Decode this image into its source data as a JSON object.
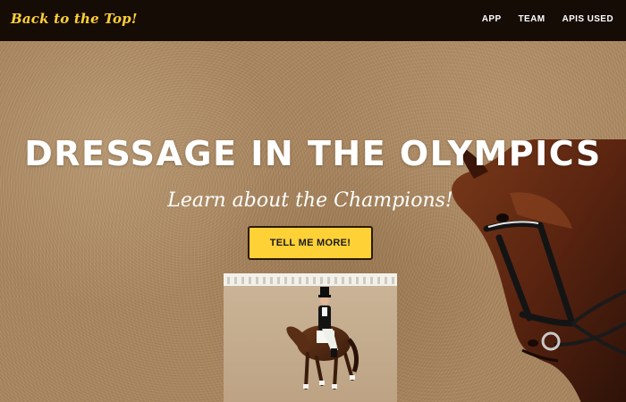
{
  "navbar": {
    "brand": "Back to the Top!",
    "links": [
      {
        "label": "APP"
      },
      {
        "label": "TEAM"
      },
      {
        "label": "APIS USED"
      }
    ]
  },
  "hero": {
    "title": "DRESSAGE IN THE OLYMPICS",
    "subtitle": "Learn about the Champions!",
    "button_label": "TELL ME MORE!"
  },
  "colors": {
    "accent": "#fed136",
    "navbar_bg": "#160c06",
    "arena_sand": "#a88660"
  },
  "icons": {
    "horse_head_image": "horse-head-icon",
    "rider_photo": "dressage-rider-photo"
  }
}
